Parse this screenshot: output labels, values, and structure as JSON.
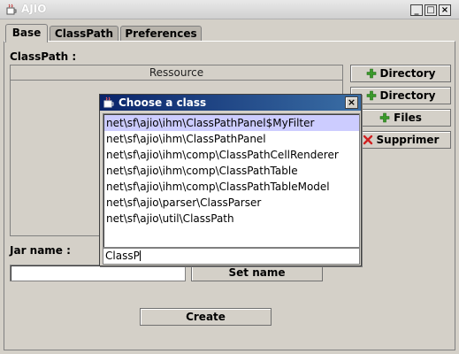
{
  "window": {
    "title": "AJIO",
    "minimize": "_",
    "maximize": "□",
    "close": "×"
  },
  "tabs": [
    {
      "label": "Base",
      "active": true
    },
    {
      "label": "ClassPath",
      "active": false
    },
    {
      "label": "Preferences",
      "active": false
    }
  ],
  "base": {
    "classpath_label": "ClassPath :",
    "table_header": "Ressource",
    "buttons": {
      "add_directory_1": "Directory",
      "add_directory_2": "Directory",
      "add_files": "Files",
      "remove": "Supprimer"
    },
    "jar_name_label": "Jar name :",
    "jar_name_value": "",
    "set_name_button": "Set name",
    "create_button": "Create"
  },
  "dialog": {
    "title": "Choose a class",
    "close": "×",
    "items": [
      "net\\sf\\ajio\\ihm\\ClassPathPanel$MyFilter",
      "net\\sf\\ajio\\ihm\\ClassPathPanel",
      "net\\sf\\ajio\\ihm\\comp\\ClassPathCellRenderer",
      "net\\sf\\ajio\\ihm\\comp\\ClassPathTable",
      "net\\sf\\ajio\\ihm\\comp\\ClassPathTableModel",
      "net\\sf\\ajio\\parser\\ClassParser",
      "net\\sf\\ajio\\util\\ClassPath"
    ],
    "selected_index": 0,
    "filter_value": "ClassP"
  },
  "colors": {
    "selection": "#ccccff",
    "dialog_title": "#0a246a",
    "add_icon": "#3a9a2a",
    "remove_icon": "#d02020"
  },
  "icons": {
    "app": "java-cup-icon",
    "add": "plus-icon",
    "remove": "x-icon"
  }
}
